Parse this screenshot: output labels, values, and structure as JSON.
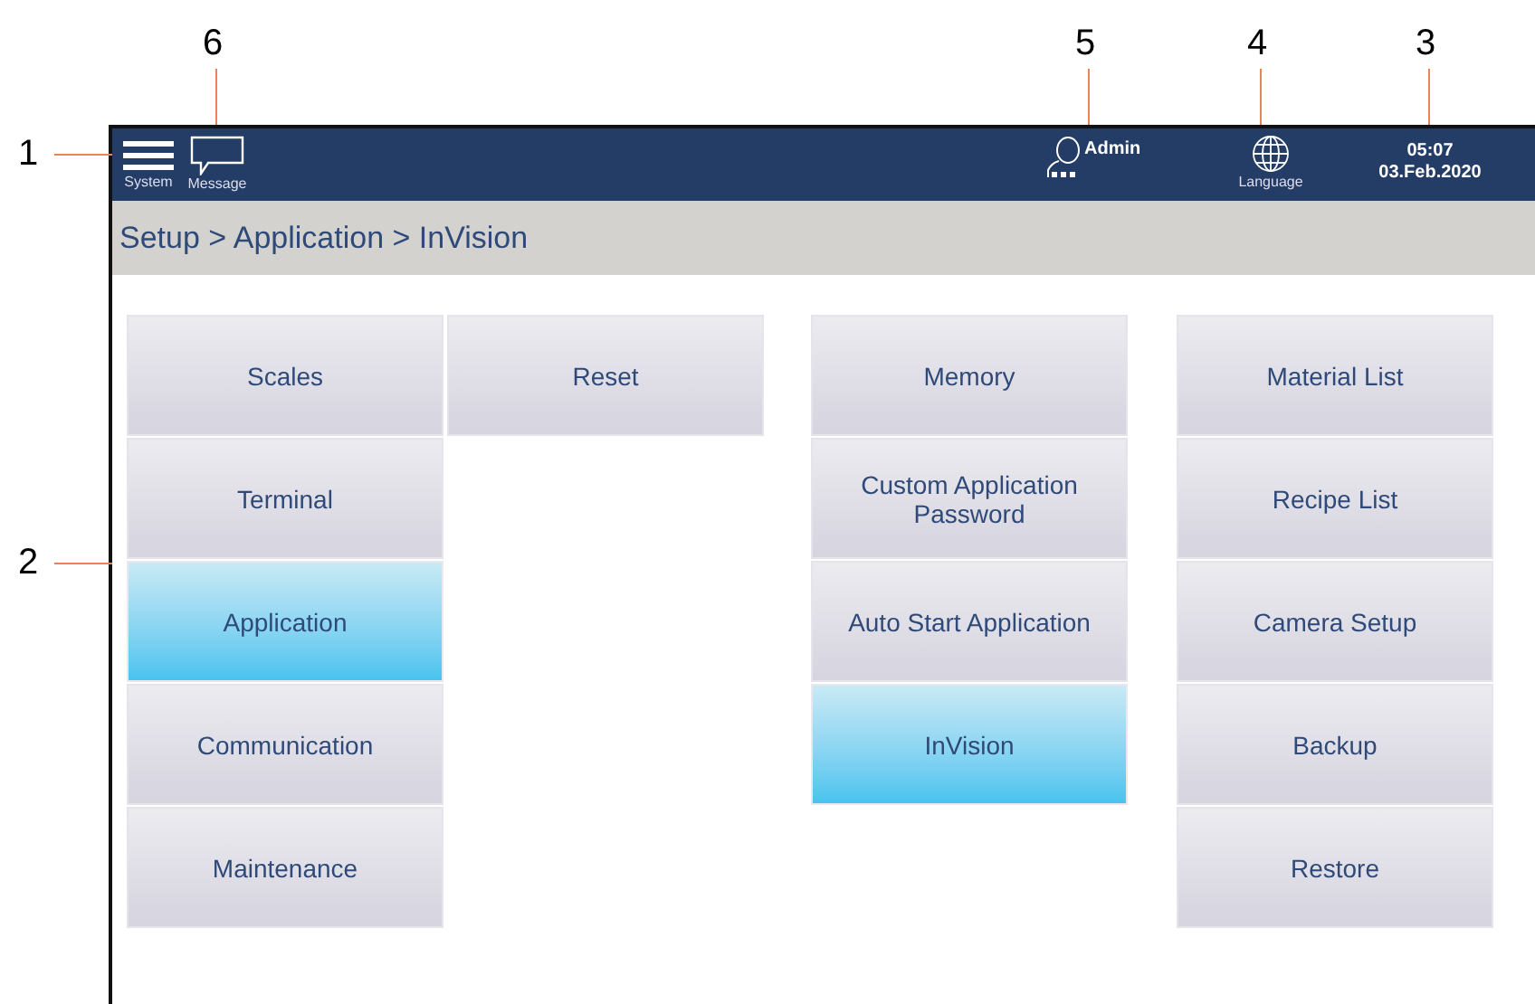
{
  "callouts": [
    {
      "label": "1"
    },
    {
      "label": "6"
    },
    {
      "label": "5"
    },
    {
      "label": "4"
    },
    {
      "label": "3"
    },
    {
      "label": "2"
    }
  ],
  "top_bar": {
    "system": "System",
    "message": "Message",
    "user": "Admin",
    "language": "Language",
    "time": "05:07",
    "date": "03.Feb.2020"
  },
  "breadcrumb": "Setup > Application > InVision",
  "menu_columns": [
    [
      {
        "label": "Scales",
        "selected": false
      },
      {
        "label": "Terminal",
        "selected": false
      },
      {
        "label": "Application",
        "selected": true
      },
      {
        "label": "Communication",
        "selected": false
      },
      {
        "label": "Maintenance",
        "selected": false
      }
    ],
    [
      {
        "label": "Reset",
        "selected": false
      }
    ],
    [
      {
        "label": "Memory",
        "selected": false
      },
      {
        "label": "Custom Application Password",
        "selected": false
      },
      {
        "label": "Auto Start Application",
        "selected": false
      },
      {
        "label": "InVision",
        "selected": true
      }
    ],
    [
      {
        "label": "Material List",
        "selected": false
      },
      {
        "label": "Recipe List",
        "selected": false
      },
      {
        "label": "Camera Setup",
        "selected": false
      },
      {
        "label": "Backup",
        "selected": false
      },
      {
        "label": "Restore",
        "selected": false
      }
    ]
  ]
}
